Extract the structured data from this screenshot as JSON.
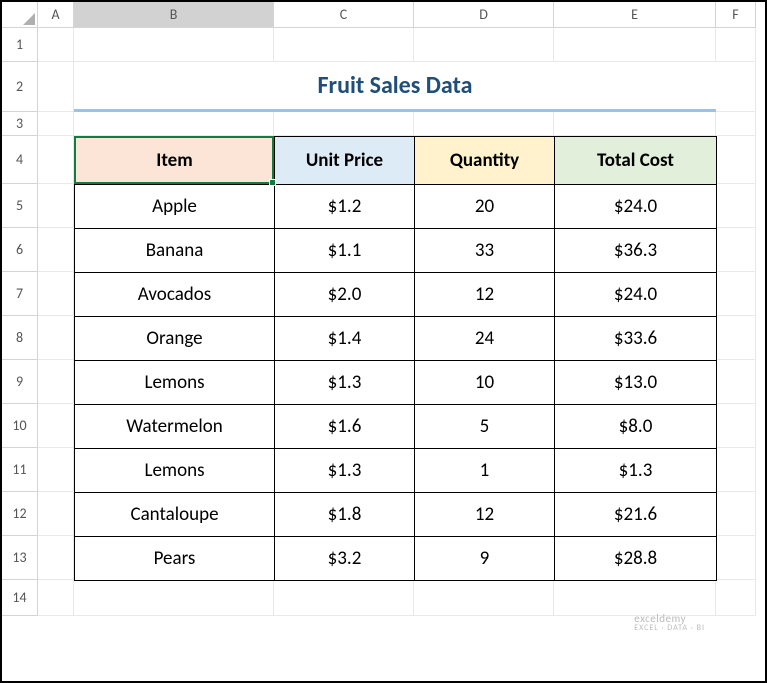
{
  "columns": [
    "A",
    "B",
    "C",
    "D",
    "E",
    "F"
  ],
  "rows": [
    "1",
    "2",
    "3",
    "4",
    "5",
    "6",
    "7",
    "8",
    "9",
    "10",
    "11",
    "12",
    "13",
    "14"
  ],
  "title": "Fruit Sales Data",
  "selected_cell": "B4",
  "headers": {
    "item": "Item",
    "unit_price": "Unit Price",
    "quantity": "Quantity",
    "total_cost": "Total Cost"
  },
  "data": [
    {
      "item": "Apple",
      "unit_price": "$1.2",
      "quantity": "20",
      "total_cost": "$24.0"
    },
    {
      "item": "Banana",
      "unit_price": "$1.1",
      "quantity": "33",
      "total_cost": "$36.3"
    },
    {
      "item": "Avocados",
      "unit_price": "$2.0",
      "quantity": "12",
      "total_cost": "$24.0"
    },
    {
      "item": "Orange",
      "unit_price": "$1.4",
      "quantity": "24",
      "total_cost": "$33.6"
    },
    {
      "item": "Lemons",
      "unit_price": "$1.3",
      "quantity": "10",
      "total_cost": "$13.0"
    },
    {
      "item": "Watermelon",
      "unit_price": "$1.6",
      "quantity": "5",
      "total_cost": "$8.0"
    },
    {
      "item": "Lemons",
      "unit_price": "$1.3",
      "quantity": "1",
      "total_cost": "$1.3"
    },
    {
      "item": "Cantaloupe",
      "unit_price": "$1.8",
      "quantity": "12",
      "total_cost": "$21.6"
    },
    {
      "item": "Pears",
      "unit_price": "$3.2",
      "quantity": "9",
      "total_cost": "$28.8"
    }
  ],
  "watermark": {
    "main": "exceldemy",
    "sub": "EXCEL · DATA · BI"
  },
  "chart_data": {
    "type": "table",
    "title": "Fruit Sales Data",
    "columns": [
      "Item",
      "Unit Price",
      "Quantity",
      "Total Cost"
    ],
    "rows": [
      [
        "Apple",
        1.2,
        20,
        24.0
      ],
      [
        "Banana",
        1.1,
        33,
        36.3
      ],
      [
        "Avocados",
        2.0,
        12,
        24.0
      ],
      [
        "Orange",
        1.4,
        24,
        33.6
      ],
      [
        "Lemons",
        1.3,
        10,
        13.0
      ],
      [
        "Watermelon",
        1.6,
        5,
        8.0
      ],
      [
        "Lemons",
        1.3,
        1,
        1.3
      ],
      [
        "Cantaloupe",
        1.8,
        12,
        21.6
      ],
      [
        "Pears",
        3.2,
        9,
        28.8
      ]
    ]
  }
}
